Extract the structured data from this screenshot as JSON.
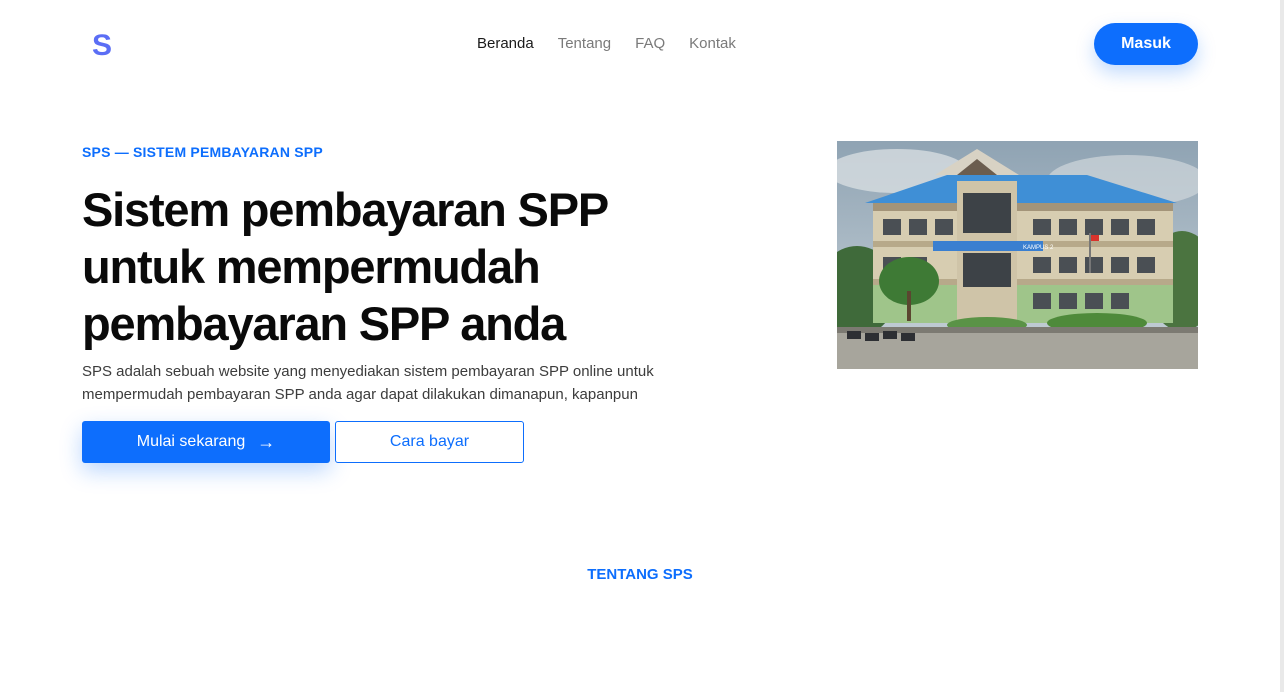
{
  "brand": {
    "logo_letter": "S",
    "logo_icon": "s-logo-icon",
    "color": "#5b6ef5"
  },
  "nav": {
    "items": [
      {
        "label": "Beranda",
        "active": true
      },
      {
        "label": "Tentang",
        "active": false
      },
      {
        "label": "FAQ",
        "active": false
      },
      {
        "label": "Kontak",
        "active": false
      }
    ],
    "login_label": "Masuk"
  },
  "hero": {
    "eyebrow": "SPS — SISTEM PEMBAYARAN SPP",
    "title_lines": [
      "Sistem pembayaran SPP",
      "untuk mempermudah",
      "pembayaran SPP anda"
    ],
    "description_lines": [
      "SPS adalah sebuah website yang menyediakan sistem pembayaran SPP online untuk",
      "mempermudah pembayaran SPP anda agar dapat dilakukan dimanapun, kapanpun"
    ],
    "primary_button": "Mulai sekarang",
    "primary_button_icon": "arrow-right-icon",
    "secondary_button": "Cara bayar",
    "image_sign": "KAMPUS 2"
  },
  "about": {
    "label": "TENTANG SPS"
  },
  "colors": {
    "accent": "#0d6efd",
    "text": "#0a0a0a",
    "muted": "#7a7a7a"
  }
}
